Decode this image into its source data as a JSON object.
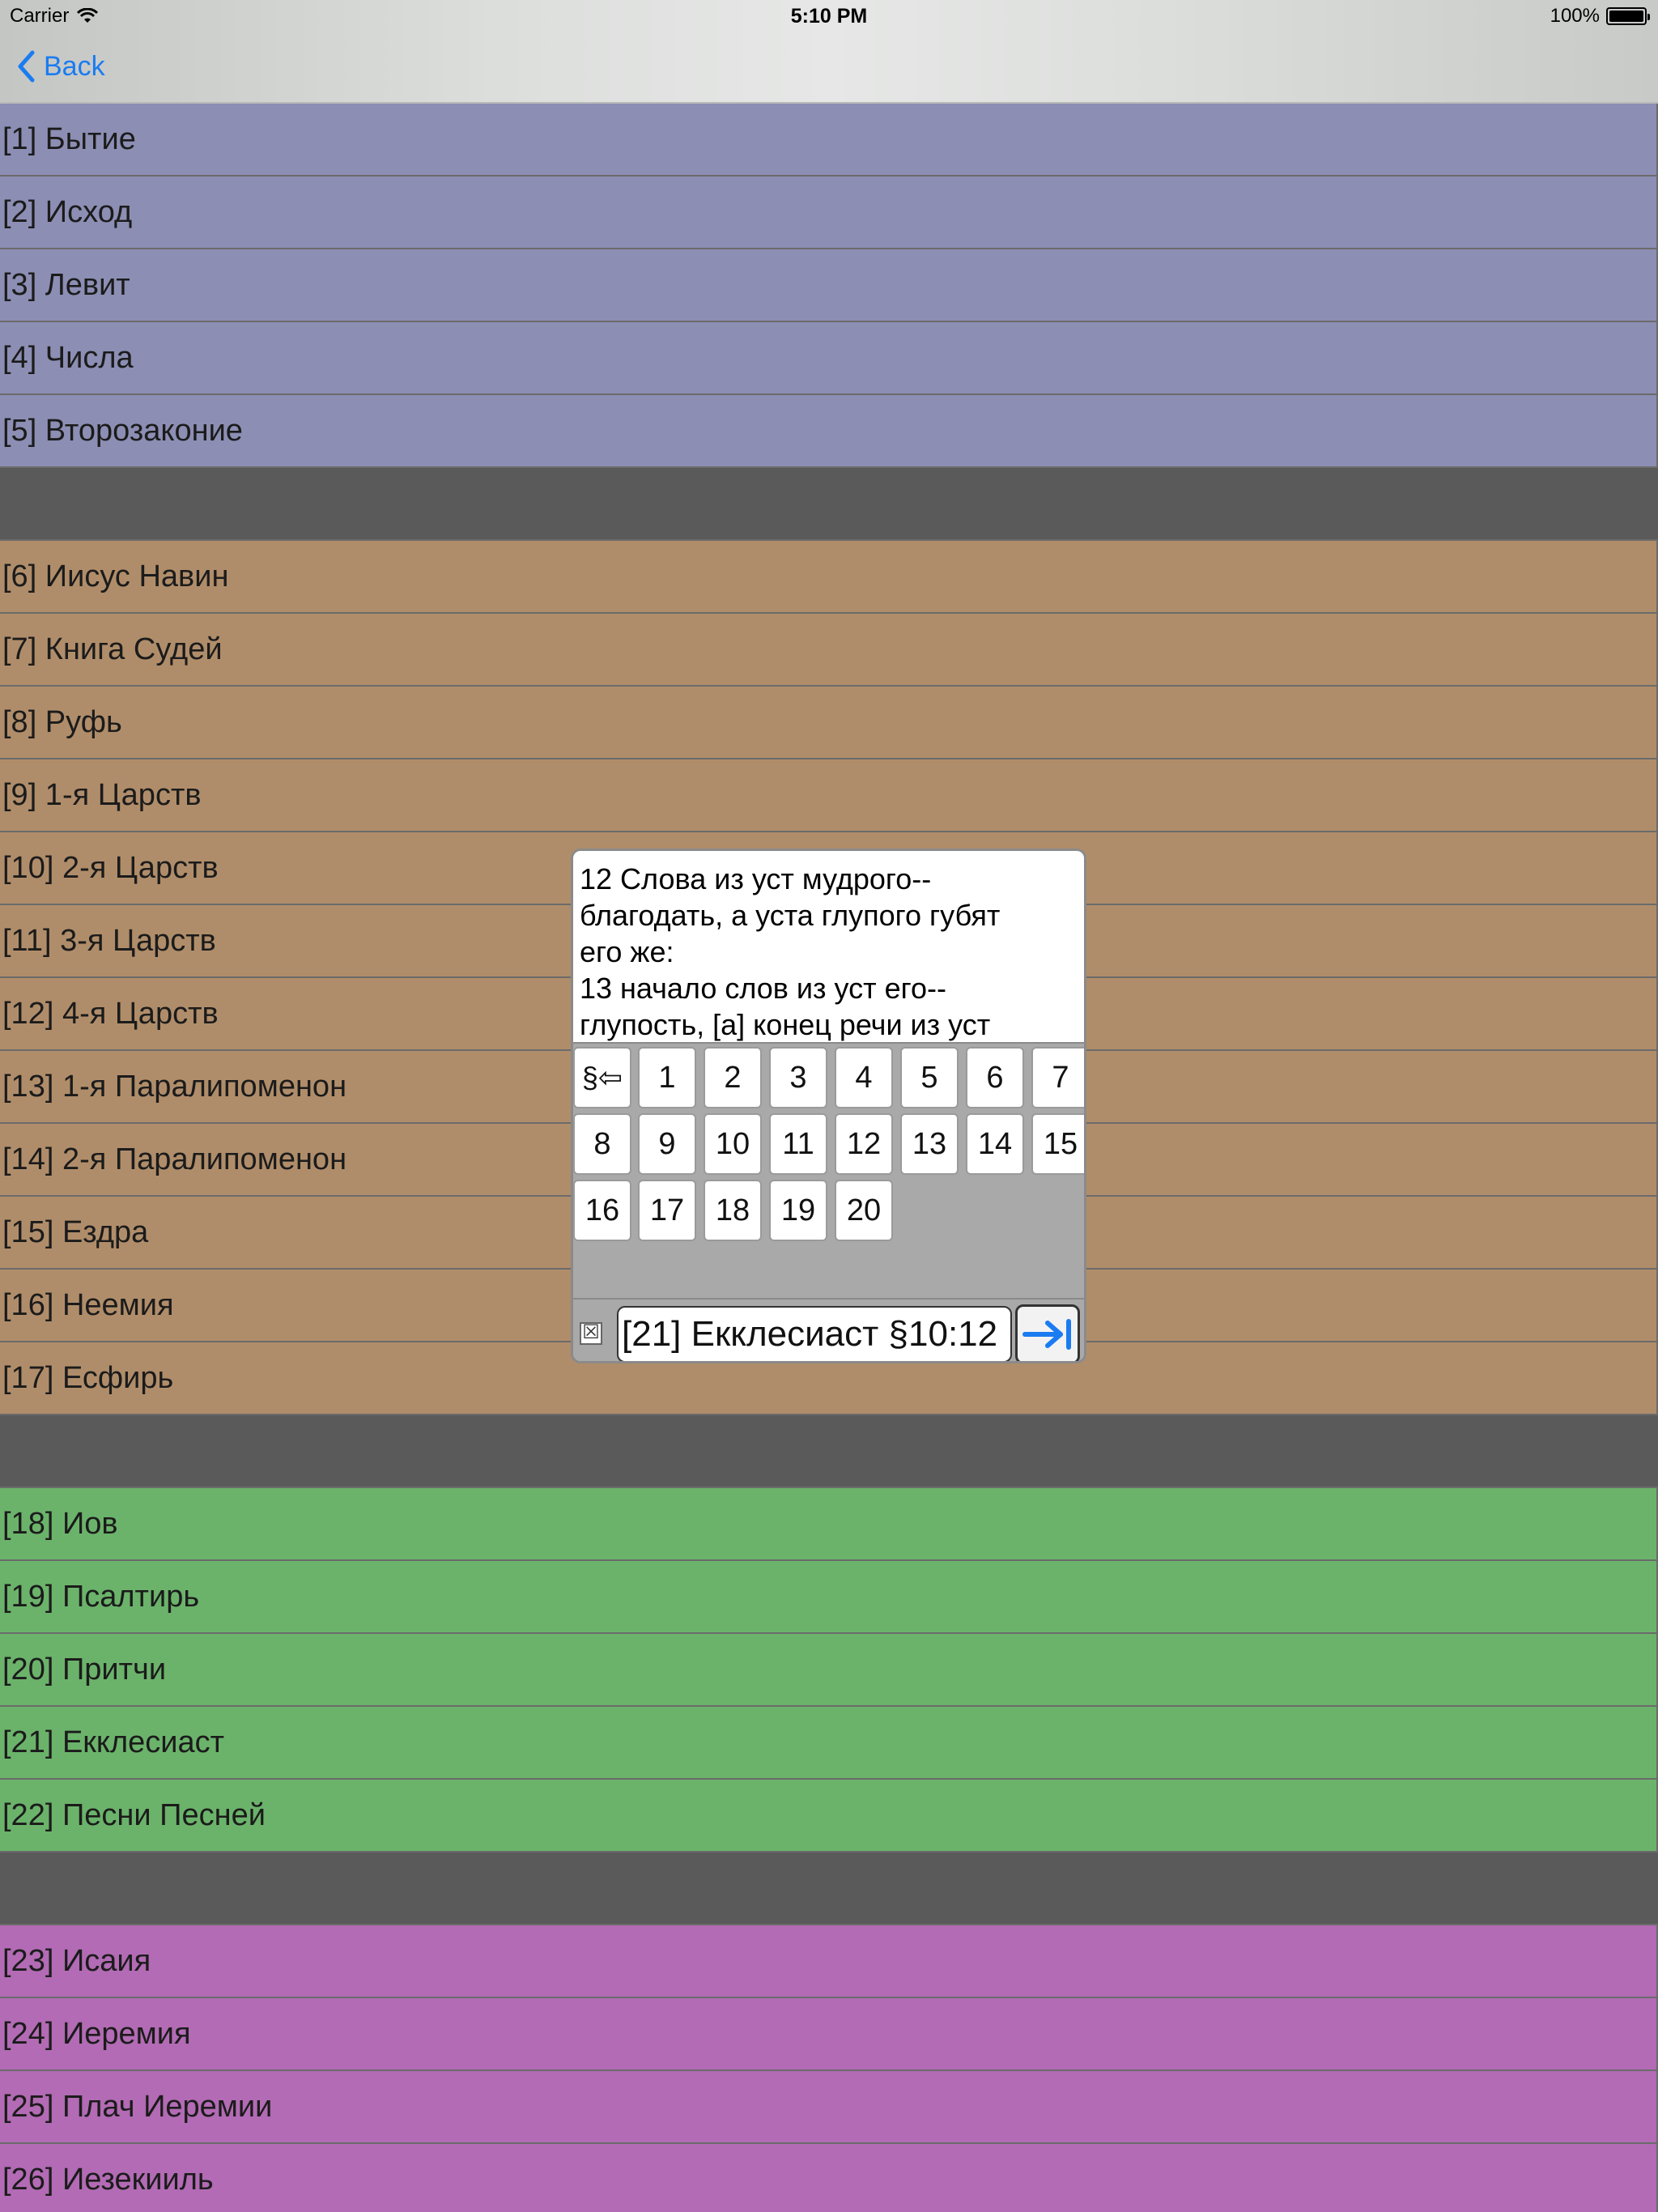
{
  "status_bar": {
    "carrier": "Carrier",
    "time": "5:10 PM",
    "battery": "100%",
    "battery_level": 1.0
  },
  "nav": {
    "back_label": "Back"
  },
  "colors": {
    "accent": "#1a7cf0",
    "law": "#8c8eb4",
    "history": "#b08d6a",
    "poetry": "#6bb36b",
    "prophets": "#b26bb4",
    "separator": "#5a5a5a"
  },
  "books": {
    "law": [
      "[1] Бытие",
      "[2] Исход",
      "[3] Левит",
      "[4] Числа",
      "[5] Второзаконие"
    ],
    "history": [
      "[6] Иисус Навин",
      "[7] Книга Судей",
      "[8] Руфь",
      "[9] 1-я Царств",
      "[10] 2-я Царств",
      "[11] 3-я Царств",
      "[12] 4-я Царств",
      "[13] 1-я Паралипоменон",
      "[14] 2-я Паралипоменон",
      "[15] Ездра",
      "[16] Неемия",
      "[17] Есфирь"
    ],
    "poetry": [
      "[18] Иов",
      "[19] Псалтирь",
      "[20] Притчи",
      "[21] Екклесиаст",
      "[22] Песни Песней"
    ],
    "prophets": [
      "[23] Исаия",
      "[24] Иеремия",
      "[25] Плач Иеремии",
      "[26] Иезекииль"
    ]
  },
  "popup": {
    "preview_text": "12 Слова из уст мудрого--\nблагодать, а уста глупого губят\nего же:\n13 начало слов из уст его--\nглупость, [а] конец речи из уст",
    "section_back_key": "§⇦",
    "number_keys": [
      "1",
      "2",
      "3",
      "4",
      "5",
      "6",
      "7",
      "8",
      "9",
      "10",
      "11",
      "12",
      "13",
      "14",
      "15",
      "16",
      "17",
      "18",
      "19",
      "20"
    ],
    "clear_icon": "☒",
    "reference_value": "[21] Екклесиаст §10:12",
    "go_icon": "arrow-to-bar-icon"
  }
}
